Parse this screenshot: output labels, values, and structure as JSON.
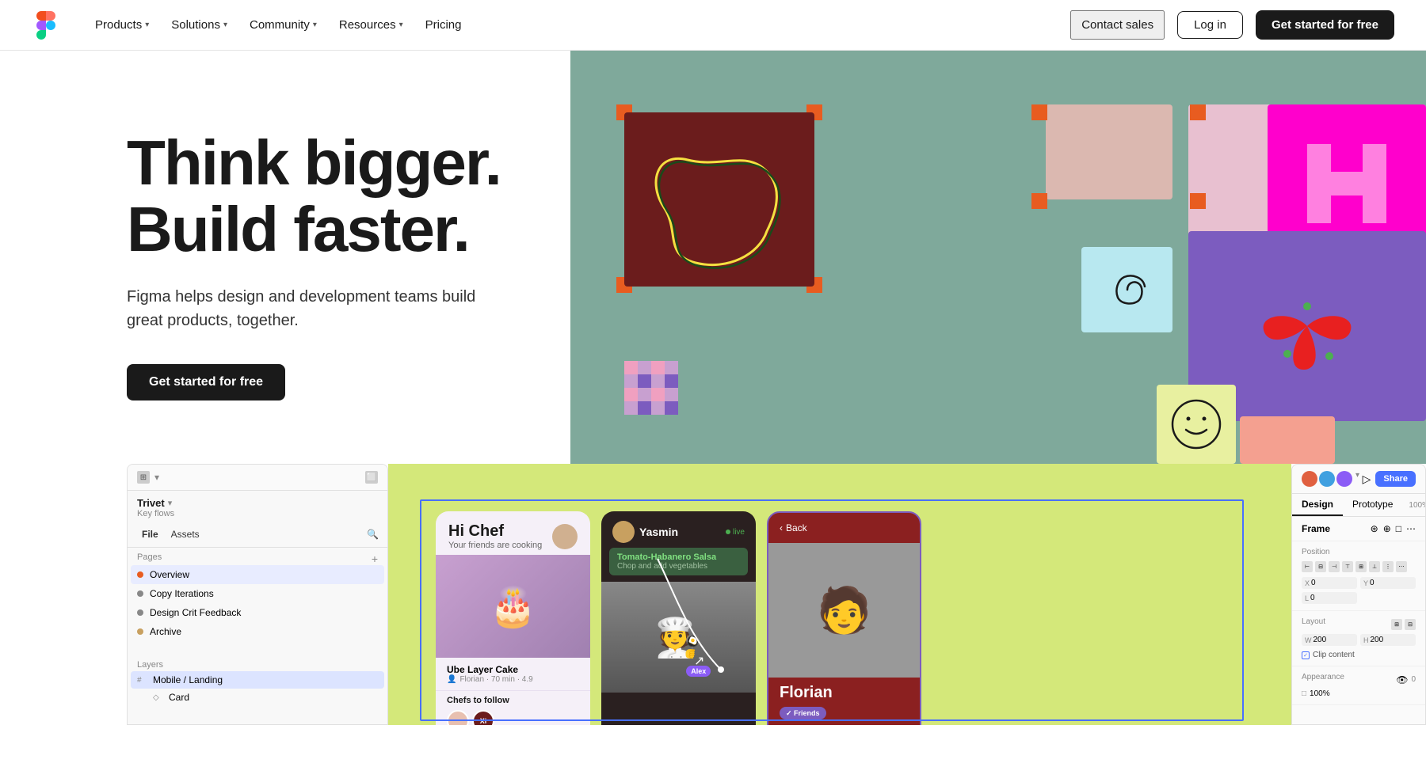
{
  "nav": {
    "logo_alt": "Figma logo",
    "items": [
      {
        "label": "Products",
        "has_chevron": true
      },
      {
        "label": "Solutions",
        "has_chevron": true
      },
      {
        "label": "Community",
        "has_chevron": true
      },
      {
        "label": "Resources",
        "has_chevron": true
      },
      {
        "label": "Pricing",
        "has_chevron": false
      }
    ],
    "contact_label": "Contact sales",
    "login_label": "Log in",
    "cta_label": "Get started for free"
  },
  "hero": {
    "title_line1": "Think bigger.",
    "title_line2": "Build faster.",
    "subtitle": "Figma helps design and development teams build great products, together.",
    "cta_label": "Get started for free"
  },
  "figma_panel": {
    "project_name": "Trivet",
    "project_sub": "Key flows",
    "tab_file": "File",
    "tab_assets": "Assets",
    "pages_label": "Pages",
    "pages": [
      {
        "label": "Overview",
        "color": "#e85c20"
      },
      {
        "label": "Copy Iterations",
        "color": "#888"
      },
      {
        "label": "Design Crit Feedback",
        "color": "#888"
      },
      {
        "label": "Archive",
        "color": "#888"
      }
    ],
    "layers_label": "Layers",
    "layers": [
      {
        "label": "Mobile / Landing",
        "icon": "#"
      },
      {
        "label": "Card",
        "icon": "◇"
      }
    ]
  },
  "app_card1": {
    "greeting": "Hi Chef",
    "sub": "Your friends are cooking",
    "item_title": "Ube Layer Cake",
    "item_meta": "Florian · 70 min · 4.9",
    "chefs_follow": "Chefs to follow"
  },
  "app_card2": {
    "name": "Yasmin",
    "live_label": "live",
    "recipe": "Tomato-Habanero Salsa",
    "step": "Chop and add vegetables"
  },
  "app_card3": {
    "back_label": "Back",
    "person_name": "Florian",
    "friends_label": "✓ Friends"
  },
  "right_panel": {
    "share_label": "Share",
    "tab_design": "Design",
    "tab_prototype": "Prototype",
    "zoom": "100%",
    "frame_label": "Frame",
    "position_label": "Position",
    "x": "0",
    "y": "0",
    "l": "0",
    "layout_label": "Layout",
    "w": "200",
    "h": "200",
    "clip_content": "Clip content",
    "appearance_label": "Appearance",
    "opacity": "100%"
  }
}
